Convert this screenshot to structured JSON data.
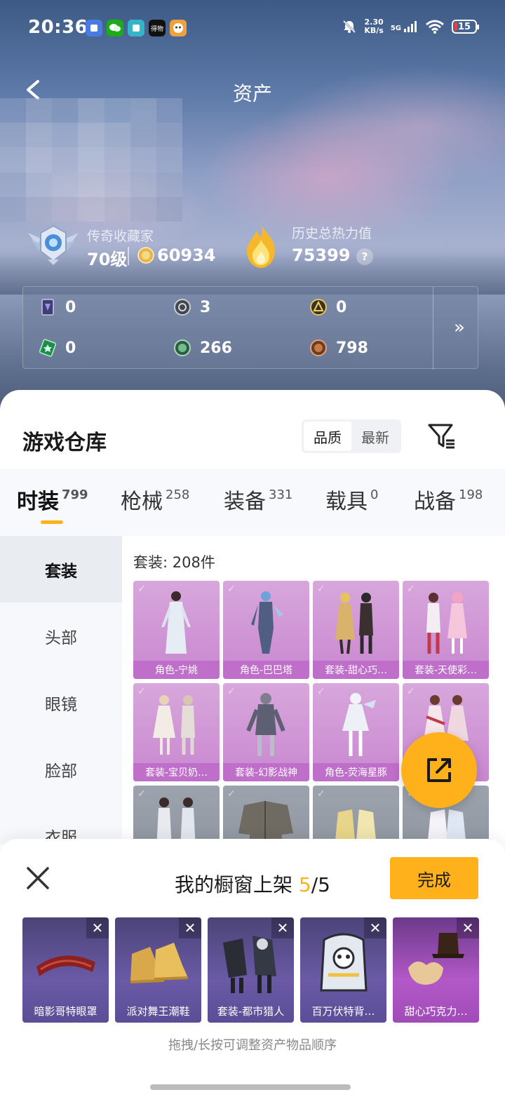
{
  "status_bar": {
    "time": "20:36",
    "net_speed_value": "2.30",
    "net_speed_unit": "KB/s",
    "signal_label": "5G",
    "battery": "15",
    "app_icons": [
      "antivirus-icon",
      "wechat-icon",
      "notes-icon",
      "dewu-icon",
      "game-icon"
    ],
    "app_icon_texts": [
      "",
      "",
      "",
      "得物",
      ""
    ]
  },
  "header": {
    "title": "资产"
  },
  "profile": {
    "collector_title": "传奇收藏家",
    "level": "70级",
    "coins": "60934",
    "heat_title": "历史总热力值",
    "heat_value": "75399",
    "help_symbol": "?"
  },
  "currencies": [
    {
      "icon": "card-icon",
      "value": "0"
    },
    {
      "icon": "silver-coin-icon",
      "value": "3"
    },
    {
      "icon": "gold-emblem-icon",
      "value": "0"
    },
    {
      "icon": "green-ticket-icon",
      "value": "0"
    },
    {
      "icon": "green-coin-icon",
      "value": "266"
    },
    {
      "icon": "bronze-coin-icon",
      "value": "798"
    }
  ],
  "expand_symbol": "»",
  "warehouse": {
    "title": "游戏仓库",
    "sort_options": [
      "品质",
      "最新"
    ],
    "active_sort": "品质"
  },
  "category_tabs": [
    {
      "label": "时装",
      "count": "799",
      "active": true
    },
    {
      "label": "枪械",
      "count": "258"
    },
    {
      "label": "装备",
      "count": "331"
    },
    {
      "label": "载具",
      "count": "0"
    },
    {
      "label": "战备",
      "count": "198"
    }
  ],
  "side_nav": [
    "套装",
    "头部",
    "眼镜",
    "脸部",
    "衣服"
  ],
  "grid": {
    "count_text": "套装: 208件",
    "items": [
      "角色-宁姚",
      "角色-巴巴塔",
      "套装-甜心巧…",
      "套装-天使彩…",
      "套装-宝贝奶…",
      "套装-幻影战神",
      "角色-荧海星豚",
      "",
      "",
      "",
      "",
      ""
    ]
  },
  "showcase": {
    "title_prefix": "我的橱窗上架",
    "current": "5",
    "total": "/5",
    "done_label": "完成",
    "remove_symbol": "✕",
    "items": [
      "暗影哥特眼罩",
      "派对舞王潮鞋",
      "套装-都市猎人",
      "百万伏特背…",
      "甜心巧克力…"
    ],
    "hint": "拖拽/长按可调整资产物品顺序"
  },
  "colors": {
    "accent": "#ffb11b",
    "card_purple": "#c987cf",
    "slot_blue": "#5b4d96",
    "slot_pink": "#b458c8"
  }
}
